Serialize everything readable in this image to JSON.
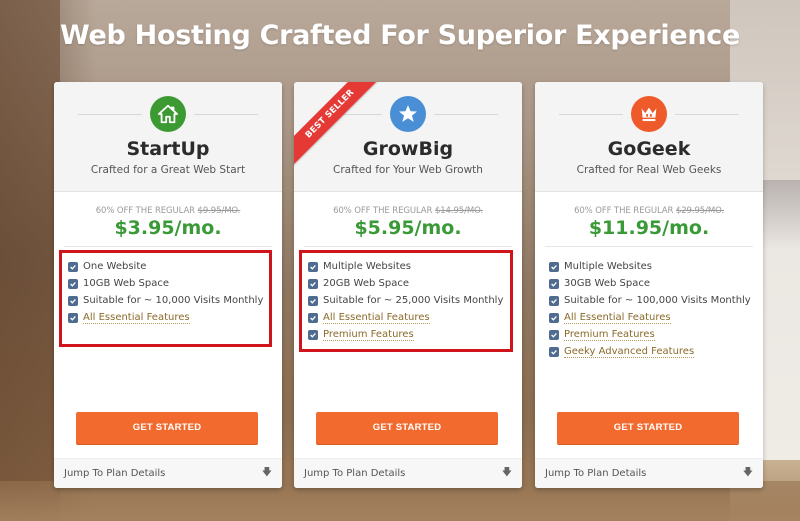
{
  "headline": "Web Hosting Crafted For Superior Experience",
  "colors": {
    "price_green": "#3a9a37",
    "cta_orange": "#f26a2e",
    "ribbon_red": "#e53935",
    "highlight_red": "#d0141c",
    "startup_icon": "#3d9a32",
    "growbig_icon": "#4a8ed6",
    "gogeek_icon": "#ee5a2a"
  },
  "plans": [
    {
      "name": "StartUp",
      "tagline": "Crafted for a Great Web Start",
      "icon": "house-icon",
      "regular_prefix": "60% OFF THE REGULAR",
      "regular_price": "$9.95/MO.",
      "price": "$3.95/mo.",
      "features": [
        {
          "label": "One Website",
          "link": false
        },
        {
          "label": "10GB Web Space",
          "link": false
        },
        {
          "label": "Suitable for ~ 10,000 Visits Monthly",
          "link": false
        },
        {
          "label": "All Essential Features",
          "link": true
        }
      ],
      "cta": "GET STARTED",
      "footer": "Jump To Plan Details",
      "highlighted": true
    },
    {
      "name": "GrowBig",
      "tagline": "Crafted for Your Web Growth",
      "icon": "star-icon",
      "ribbon": "BEST SELLER",
      "regular_prefix": "60% OFF THE REGULAR",
      "regular_price": "$14.95/MO.",
      "price": "$5.95/mo.",
      "features": [
        {
          "label": "Multiple Websites",
          "link": false
        },
        {
          "label": "20GB Web Space",
          "link": false
        },
        {
          "label": "Suitable for ~ 25,000 Visits Monthly",
          "link": false
        },
        {
          "label": "All Essential Features",
          "link": true
        },
        {
          "label": "Premium Features",
          "link": true
        }
      ],
      "cta": "GET STARTED",
      "footer": "Jump To Plan Details",
      "highlighted": true
    },
    {
      "name": "GoGeek",
      "tagline": "Crafted for Real Web Geeks",
      "icon": "crown-icon",
      "regular_prefix": "60% OFF THE REGULAR",
      "regular_price": "$29.95/MO.",
      "price": "$11.95/mo.",
      "features": [
        {
          "label": "Multiple Websites",
          "link": false
        },
        {
          "label": "30GB Web Space",
          "link": false
        },
        {
          "label": "Suitable for ~ 100,000 Visits Monthly",
          "link": false
        },
        {
          "label": "All Essential Features",
          "link": true
        },
        {
          "label": "Premium Features",
          "link": true
        },
        {
          "label": "Geeky Advanced Features",
          "link": true
        }
      ],
      "cta": "GET STARTED",
      "footer": "Jump To Plan Details",
      "highlighted": false
    }
  ]
}
